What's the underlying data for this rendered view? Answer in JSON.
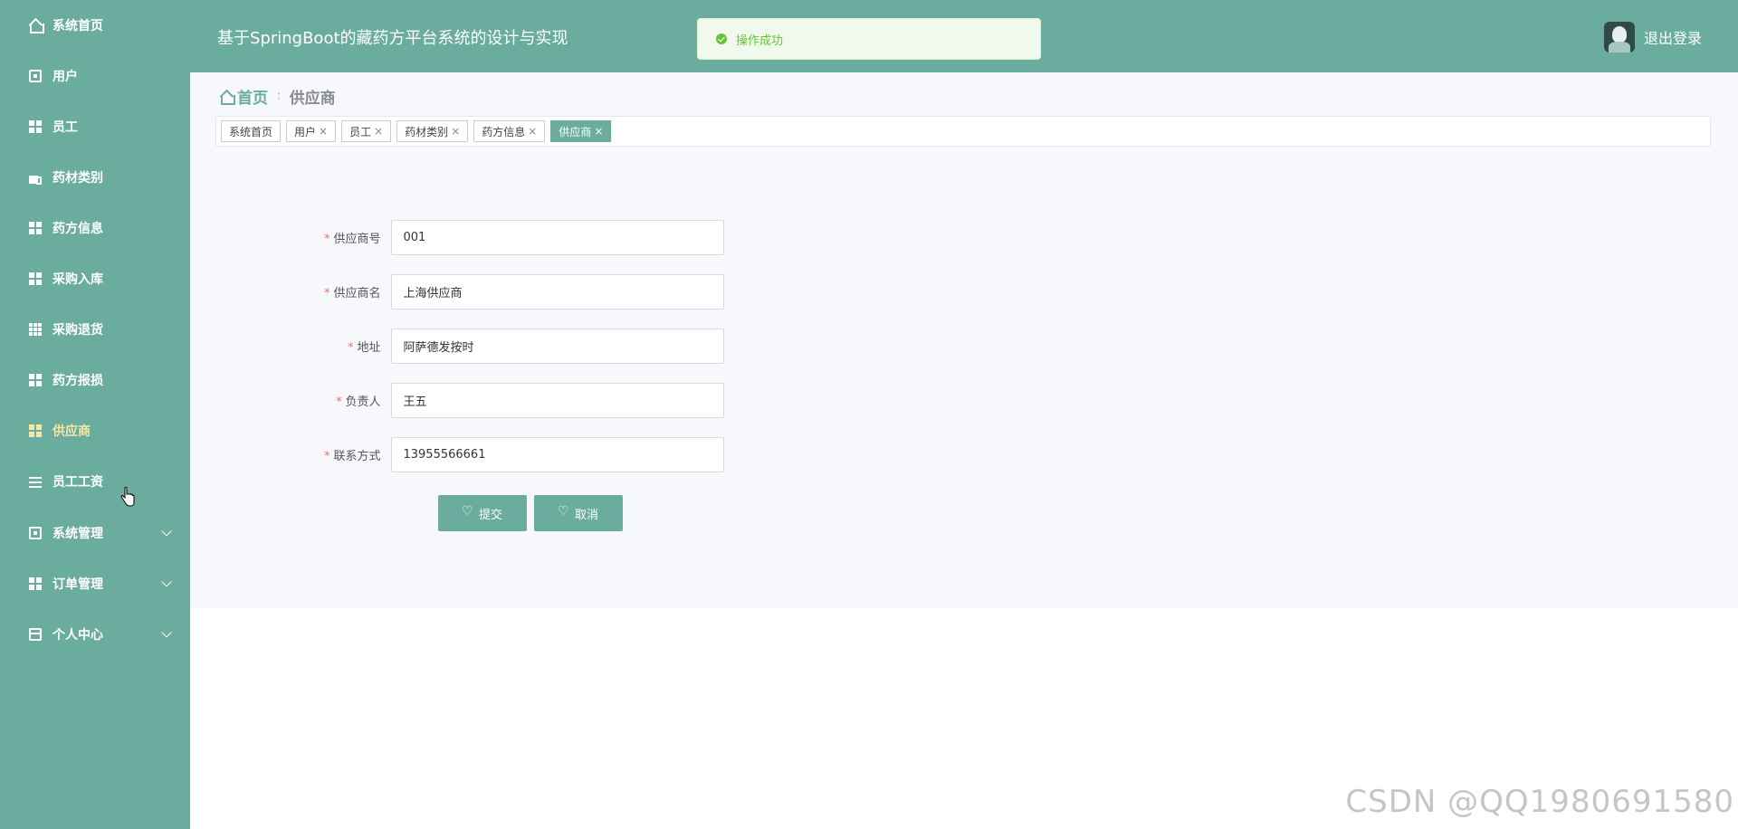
{
  "sidebar": {
    "items": [
      {
        "label": "系统首页",
        "icon": "home-icon"
      },
      {
        "label": "用户",
        "icon": "clipboard-icon"
      },
      {
        "label": "员工",
        "icon": "grid-icon"
      },
      {
        "label": "药材类别",
        "icon": "cup-icon"
      },
      {
        "label": "药方信息",
        "icon": "grid-icon"
      },
      {
        "label": "采购入库",
        "icon": "grid-icon"
      },
      {
        "label": "采购退货",
        "icon": "table-icon"
      },
      {
        "label": "药方报损",
        "icon": "grid-icon"
      },
      {
        "label": "供应商",
        "icon": "grid-icon",
        "active": true
      },
      {
        "label": "员工工资",
        "icon": "sliders-icon"
      },
      {
        "label": "系统管理",
        "icon": "clipboard-icon",
        "expandable": true
      },
      {
        "label": "订单管理",
        "icon": "grid-icon",
        "expandable": true
      },
      {
        "label": "个人中心",
        "icon": "card-icon",
        "expandable": true
      }
    ]
  },
  "header": {
    "title": "基于SpringBoot的藏药方平台系统的设计与实现",
    "logout_label": "退出登录"
  },
  "toast": {
    "message": "操作成功",
    "type": "success"
  },
  "breadcrumb": {
    "home": "首页",
    "separator": "∶",
    "current": "供应商"
  },
  "tabs": [
    {
      "label": "系统首页",
      "closable": false
    },
    {
      "label": "用户",
      "closable": true
    },
    {
      "label": "员工",
      "closable": true
    },
    {
      "label": "药材类别",
      "closable": true
    },
    {
      "label": "药方信息",
      "closable": true
    },
    {
      "label": "供应商",
      "closable": true,
      "active": true
    }
  ],
  "tab_close_glyph": "×",
  "form": {
    "fields": [
      {
        "label": "供应商号",
        "value": "001",
        "required": true
      },
      {
        "label": "供应商名",
        "value": "上海供应商",
        "required": true
      },
      {
        "label": "地址",
        "value": "阿萨德发按时",
        "required": true
      },
      {
        "label": "负责人",
        "value": "王五",
        "required": true
      },
      {
        "label": "联系方式",
        "value": "13955566661",
        "required": true
      }
    ],
    "required_mark": "*",
    "submit_label": "提交",
    "cancel_label": "取消"
  },
  "watermark": "CSDN @QQ1980691580",
  "colors": {
    "primary": "#6aac9d",
    "active_menu": "#f7e6a6",
    "success": "#67c23a",
    "required": "#f56c6c"
  }
}
